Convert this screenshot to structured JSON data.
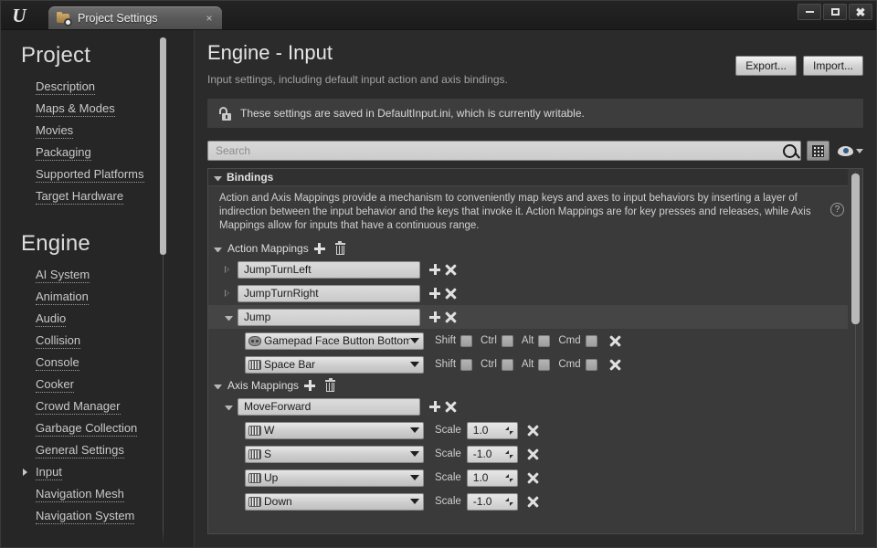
{
  "window": {
    "logo": "unreal-engine-logo",
    "tab": {
      "title": "Project Settings",
      "icon": "folder-gear-icon",
      "close": "×"
    },
    "controls": {
      "minimize": "minimize-icon",
      "restore": "restore-icon",
      "close": "✖"
    }
  },
  "sidebar": {
    "sections": [
      {
        "heading": "Project",
        "items": [
          {
            "label": "Description",
            "selected": false
          },
          {
            "label": "Maps & Modes",
            "selected": false
          },
          {
            "label": "Movies",
            "selected": false
          },
          {
            "label": "Packaging",
            "selected": false
          },
          {
            "label": "Supported Platforms",
            "selected": false
          },
          {
            "label": "Target Hardware",
            "selected": false
          }
        ]
      },
      {
        "heading": "Engine",
        "items": [
          {
            "label": "AI System",
            "selected": false
          },
          {
            "label": "Animation",
            "selected": false
          },
          {
            "label": "Audio",
            "selected": false
          },
          {
            "label": "Collision",
            "selected": false
          },
          {
            "label": "Console",
            "selected": false
          },
          {
            "label": "Cooker",
            "selected": false
          },
          {
            "label": "Crowd Manager",
            "selected": false
          },
          {
            "label": "Garbage Collection",
            "selected": false
          },
          {
            "label": "General Settings",
            "selected": false
          },
          {
            "label": "Input",
            "selected": true
          },
          {
            "label": "Navigation Mesh",
            "selected": false
          },
          {
            "label": "Navigation System",
            "selected": false
          }
        ]
      }
    ]
  },
  "main": {
    "title": "Engine - Input",
    "subtitle": "Input settings, including default input action and axis bindings.",
    "buttons": {
      "export": "Export...",
      "import": "Import..."
    },
    "infobar": {
      "icon": "unlocked-padlock-icon",
      "text": "These settings are saved in DefaultInput.ini, which is currently writable."
    },
    "search": {
      "placeholder": "Search",
      "value": ""
    },
    "toolbar": {
      "grid_icon": "grid-view-icon",
      "eye_icon": "visibility-eye-icon",
      "chevron": "chevron-down-icon"
    }
  },
  "bindings": {
    "header": "Bindings",
    "description": "Action and Axis Mappings provide a mechanism to conveniently map keys and axes to input behaviors by inserting a layer of indirection between the input behavior and the keys that invoke it. Action Mappings are for key presses and releases, while Axis Mappings allow for inputs that have a continuous range.",
    "help": "?",
    "action_group": {
      "label": "Action Mappings",
      "add": "add-icon",
      "delete": "delete-icon"
    },
    "action_mappings": [
      {
        "name": "JumpTurnLeft",
        "expanded": false,
        "highlight": false,
        "keys": []
      },
      {
        "name": "JumpTurnRight",
        "expanded": false,
        "highlight": false,
        "keys": []
      },
      {
        "name": "Jump",
        "expanded": true,
        "highlight": true,
        "keys": [
          {
            "key": "Gamepad Face Button Bottom",
            "device": "gamepad",
            "shift": false,
            "ctrl": false,
            "alt": false,
            "cmd": false
          },
          {
            "key": "Space Bar",
            "device": "keyboard",
            "shift": false,
            "ctrl": false,
            "alt": false,
            "cmd": false
          }
        ]
      }
    ],
    "modifier_labels": {
      "shift": "Shift",
      "ctrl": "Ctrl",
      "alt": "Alt",
      "cmd": "Cmd"
    },
    "axis_group": {
      "label": "Axis Mappings",
      "add": "add-icon",
      "delete": "delete-icon"
    },
    "axis_mappings": [
      {
        "name": "MoveForward",
        "expanded": true,
        "highlight": false,
        "scale_label": "Scale",
        "keys": [
          {
            "key": "W",
            "device": "keyboard",
            "scale": "1.0"
          },
          {
            "key": "S",
            "device": "keyboard",
            "scale": "-1.0"
          },
          {
            "key": "Up",
            "device": "keyboard",
            "scale": "1.0"
          },
          {
            "key": "Down",
            "device": "keyboard",
            "scale": "-1.0"
          }
        ]
      }
    ]
  }
}
